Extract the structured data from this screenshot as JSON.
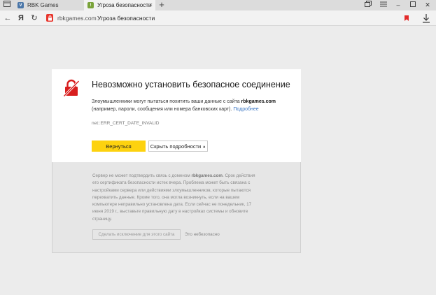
{
  "tabs": [
    {
      "title": "RBK Games",
      "favicon": "vk-icon",
      "active": false
    },
    {
      "title": "Угроза безопасности",
      "favicon": "warning-icon",
      "active": true
    }
  ],
  "toolbar": {
    "host": "rbkgames.com",
    "page_title": "Угроза безопасности",
    "yandex_logo": "Я"
  },
  "error": {
    "title": "Невозможно установить безопасное соединение",
    "desc_before": "Злоумышленники могут пытаться похитить ваши данные с сайта",
    "desc_site": "rbkgames.com",
    "desc_after": "(например, пароли, сообщения или номера банковских карт).",
    "more_link": "Подробнее",
    "code": "net::ERR_CERT_DATE_INVALID",
    "back_button": "Вернуться",
    "details_button": "Скрыть подробности"
  },
  "details": {
    "text_before": "Сервер не может подтвердить связь с доменом",
    "text_site": "rbkgames.com",
    "text_after": ". Срок действия его сертификата безопасности истек вчера. Проблема может быть связана с настройками сервера или действиями злоумышленников, которые пытаются перехватить данные. Кроме того, она могла возникнуть, если на вашем компьютере неправильно установлена дата. Если сейчас не понедельник, 17 июня 2019 г., выставьте правильную дату в настройках системы и обновите страницу.",
    "exception_button": "Сделать исключение для этого сайта",
    "unsafe_note": "Это небезопасно"
  },
  "colors": {
    "accent_yellow": "#fdd20f",
    "brand_red": "#e7352c",
    "link_blue": "#3a76c4"
  }
}
